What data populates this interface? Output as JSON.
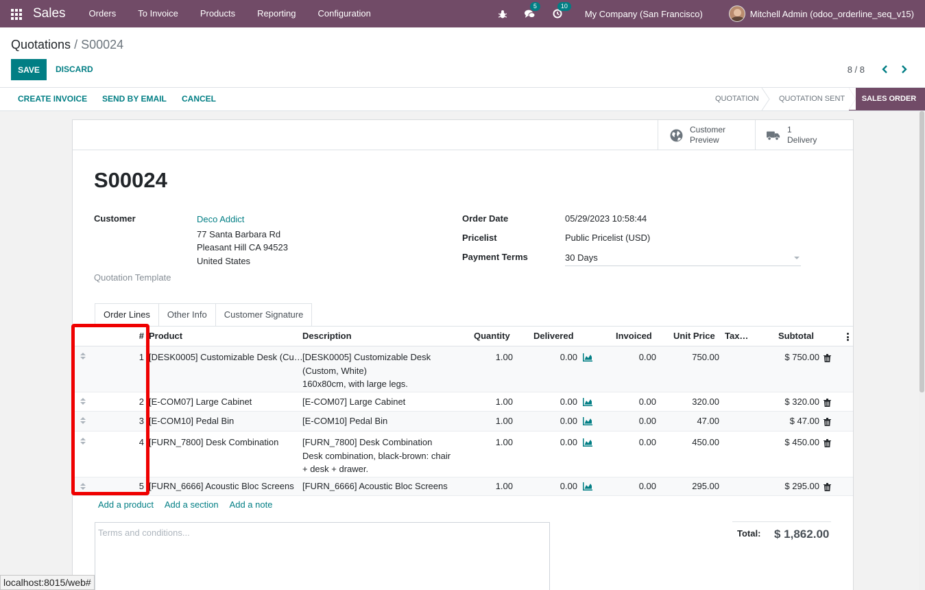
{
  "navbar": {
    "app_name": "Sales",
    "menu": [
      "Orders",
      "To Invoice",
      "Products",
      "Reporting",
      "Configuration"
    ],
    "messages_count": "5",
    "activities_count": "10",
    "company": "My Company (San Francisco)",
    "user": "Mitchell Admin (odoo_orderline_seq_v15)",
    "bg_color": "#714b67"
  },
  "breadcrumb": {
    "parent": "Quotations",
    "separator": " / ",
    "current": "S00024"
  },
  "actions": {
    "save": "SAVE",
    "discard": "DISCARD"
  },
  "pager": {
    "value": "8 / 8"
  },
  "statusbar": {
    "buttons": [
      "CREATE INVOICE",
      "SEND BY EMAIL",
      "CANCEL"
    ],
    "stages": [
      "QUOTATION",
      "QUOTATION SENT"
    ],
    "active_stage": "SALES ORDER"
  },
  "smart_buttons": {
    "preview": {
      "line1": "Customer",
      "line2": "Preview"
    },
    "delivery": {
      "line1": "1",
      "line2": "Delivery"
    }
  },
  "form": {
    "title": "S00024",
    "customer_label": "Customer",
    "customer_name": "Deco Addict",
    "address": [
      "77 Santa Barbara Rd",
      "Pleasant Hill CA 94523",
      "United States"
    ],
    "quotation_template_label": "Quotation Template",
    "order_date_label": "Order Date",
    "order_date": "05/29/2023 10:58:44",
    "pricelist_label": "Pricelist",
    "pricelist": "Public Pricelist (USD)",
    "payment_terms_label": "Payment Terms",
    "payment_terms": "30 Days"
  },
  "tabs": [
    "Order Lines",
    "Other Info",
    "Customer Signature"
  ],
  "table": {
    "headers": {
      "seq": "#",
      "product": "Product",
      "description": "Description",
      "quantity": "Quantity",
      "delivered": "Delivered",
      "invoiced": "Invoiced",
      "unit_price": "Unit Price",
      "taxes": "Tax…",
      "subtotal": "Subtotal"
    },
    "rows": [
      {
        "seq": "1",
        "product": "[DESK0005] Customizable Desk (Cu…",
        "description": [
          "[DESK0005] Customizable Desk",
          "(Custom, White)",
          "160x80cm, with large legs."
        ],
        "quantity": "1.00",
        "delivered": "0.00",
        "invoiced": "0.00",
        "unit_price": "750.00",
        "subtotal": "$ 750.00"
      },
      {
        "seq": "2",
        "product": "[E-COM07] Large Cabinet",
        "description": [
          "[E-COM07] Large Cabinet"
        ],
        "quantity": "1.00",
        "delivered": "0.00",
        "invoiced": "0.00",
        "unit_price": "320.00",
        "subtotal": "$ 320.00"
      },
      {
        "seq": "3",
        "product": "[E-COM10] Pedal Bin",
        "description": [
          "[E-COM10] Pedal Bin"
        ],
        "quantity": "1.00",
        "delivered": "0.00",
        "invoiced": "0.00",
        "unit_price": "47.00",
        "subtotal": "$ 47.00"
      },
      {
        "seq": "4",
        "product": "[FURN_7800] Desk Combination",
        "description": [
          "[FURN_7800] Desk Combination",
          "Desk combination, black-brown: chair",
          "+ desk + drawer."
        ],
        "quantity": "1.00",
        "delivered": "0.00",
        "invoiced": "0.00",
        "unit_price": "450.00",
        "subtotal": "$ 450.00"
      },
      {
        "seq": "5",
        "product": "[FURN_6666] Acoustic Bloc Screens",
        "description": [
          "[FURN_6666] Acoustic Bloc Screens"
        ],
        "quantity": "1.00",
        "delivered": "0.00",
        "invoiced": "0.00",
        "unit_price": "295.00",
        "subtotal": "$ 295.00"
      }
    ]
  },
  "add_links": [
    "Add a product",
    "Add a section",
    "Add a note"
  ],
  "terms_placeholder": "Terms and conditions...",
  "total": {
    "label": "Total:",
    "value": "$ 1,862.00"
  },
  "status_url": "localhost:8015/web#",
  "annotation_color": "#ef0000"
}
